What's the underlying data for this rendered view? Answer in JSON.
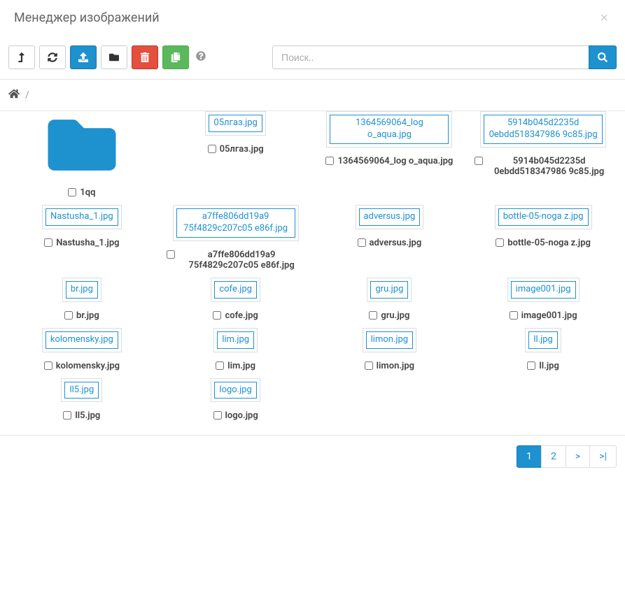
{
  "title": "Менеджер изображений",
  "search": {
    "placeholder": "Поиск.."
  },
  "breadcrumb": {
    "sep": "/"
  },
  "items": [
    {
      "type": "folder",
      "name": "1qq"
    },
    {
      "type": "file",
      "name": "05лгаз.jpg"
    },
    {
      "type": "file",
      "name": "1364569064_log o_aqua.jpg"
    },
    {
      "type": "file",
      "name": "5914b045d2235d 0ebdd518347986 9c85.jpg"
    },
    {
      "type": "file",
      "name": "Nastusha_1.jpg"
    },
    {
      "type": "file",
      "name": "a7ffe806dd19a9 75f4829c207c05 e86f.jpg"
    },
    {
      "type": "file",
      "name": "adversus.jpg"
    },
    {
      "type": "file",
      "name": "bottle-05-noga z.jpg"
    },
    {
      "type": "file",
      "name": "br.jpg"
    },
    {
      "type": "file",
      "name": "cofe.jpg"
    },
    {
      "type": "file",
      "name": "gru.jpg"
    },
    {
      "type": "file",
      "name": "image001.jpg"
    },
    {
      "type": "file",
      "name": "kolomensky.jpg"
    },
    {
      "type": "file",
      "name": "lim.jpg"
    },
    {
      "type": "file",
      "name": "limon.jpg"
    },
    {
      "type": "file",
      "name": "ll.jpg"
    },
    {
      "type": "file",
      "name": "ll5.jpg"
    },
    {
      "type": "file",
      "name": "logo.jpg"
    }
  ],
  "pagination": {
    "pages": [
      "1",
      "2"
    ],
    "next": ">",
    "last": ">|",
    "active": 0
  }
}
